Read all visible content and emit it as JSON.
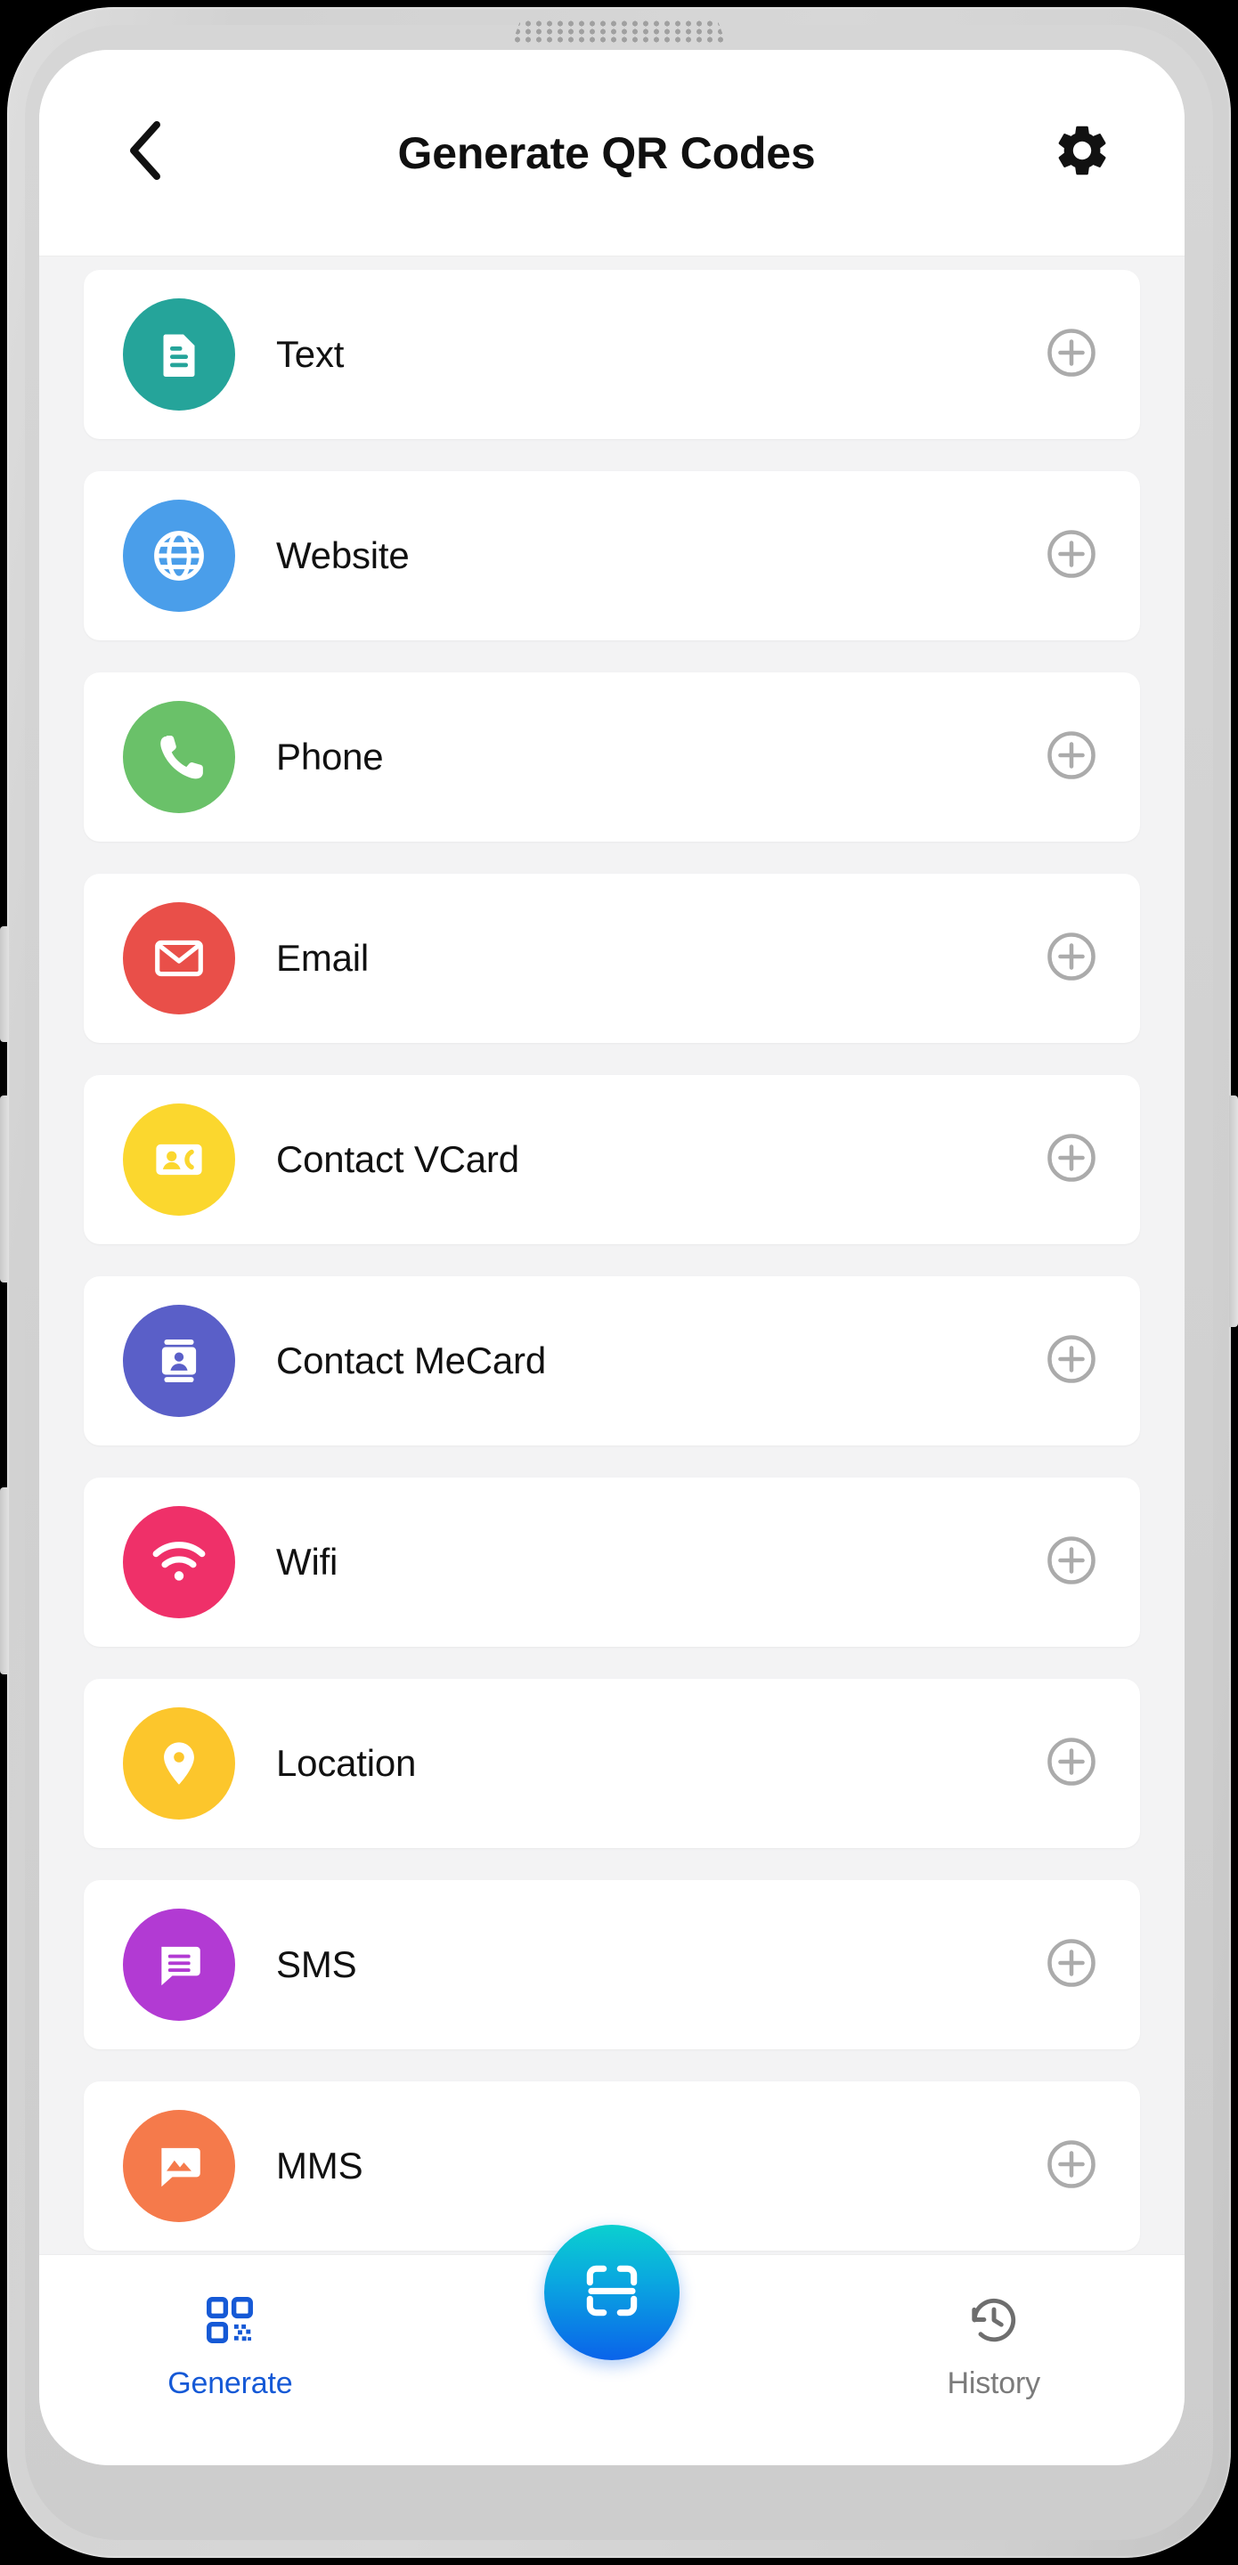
{
  "appbar": {
    "back_icon": "chevron-left-icon",
    "title": "Generate QR Codes",
    "settings_icon": "gear-icon"
  },
  "list": {
    "add_icon": "plus-circle-icon",
    "items": [
      {
        "label": "Text",
        "icon": "document-icon",
        "color": "#25a49a"
      },
      {
        "label": "Website",
        "icon": "globe-icon",
        "color": "#4a9eea"
      },
      {
        "label": "Phone",
        "icon": "phone-icon",
        "color": "#6ac169"
      },
      {
        "label": "Email",
        "icon": "envelope-icon",
        "color": "#e94f49"
      },
      {
        "label": "Contact VCard",
        "icon": "contact-card-icon",
        "color": "#fbd72e"
      },
      {
        "label": "Contact MeCard",
        "icon": "id-badge-icon",
        "color": "#5a5fc8"
      },
      {
        "label": "Wifi",
        "icon": "wifi-icon",
        "color": "#ef3069"
      },
      {
        "label": "Location",
        "icon": "map-pin-icon",
        "color": "#fcc62c"
      },
      {
        "label": "SMS",
        "icon": "chat-lines-icon",
        "color": "#b23ad3"
      },
      {
        "label": "MMS",
        "icon": "chat-image-icon",
        "color": "#f57a4b"
      }
    ]
  },
  "bottom_nav": {
    "generate": {
      "label": "Generate",
      "icon": "qr-code-icon",
      "color": "#1559d6"
    },
    "scan": {
      "icon": "scan-frame-icon"
    },
    "history": {
      "label": "History",
      "icon": "clock-rotate-icon",
      "color": "#7b7b7b"
    }
  }
}
